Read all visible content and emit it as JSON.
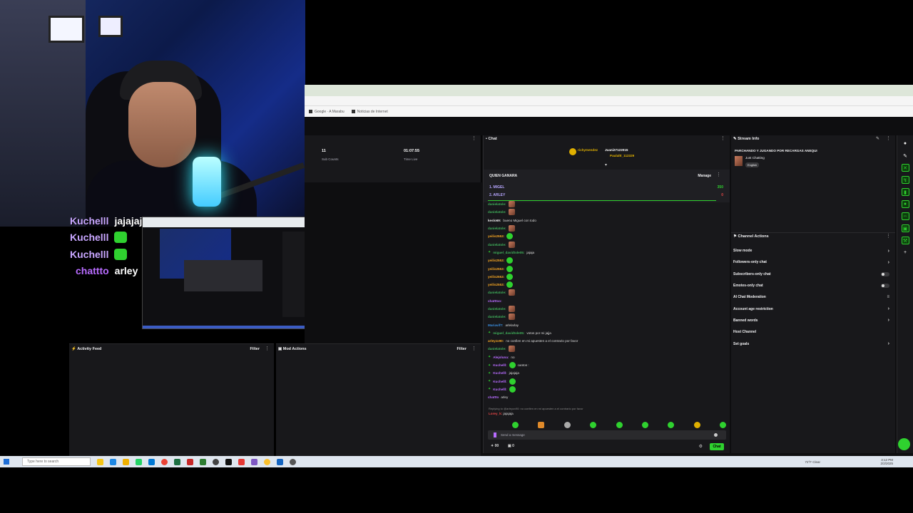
{
  "overlay_chat": [
    {
      "user": "Kuchelll",
      "msg": "jajajaja",
      "emote": false
    },
    {
      "user": "Kuchelll",
      "msg": "",
      "emote": true
    },
    {
      "user": "Kuchelll",
      "msg": "",
      "emote": true
    },
    {
      "user": "chattto",
      "msg": "arley",
      "emote": false
    }
  ],
  "bookmarks": [
    "Google · A Marabu",
    "Noticias de Internet"
  ],
  "stats": {
    "sub_value": "11",
    "sub_label": "Sub Counts",
    "time_value": "01:07:55",
    "time_label": "Time Live"
  },
  "chat": {
    "title": "Chat",
    "gifters": [
      {
        "name": "richymendez",
        "count": "1"
      },
      {
        "name": "Juani27122015",
        "count": "1"
      },
      {
        "name": "Paulaltt_112329",
        "count": "1"
      }
    ],
    "prediction": {
      "title": "QUIEN GANARA",
      "manage": "Manage",
      "options": [
        {
          "name": "1. MIGEL",
          "points": "350"
        },
        {
          "name": "2. ARLEY",
          "points": "0"
        }
      ]
    },
    "messages": [
      {
        "user": "danielatole:",
        "color": "#3fae5a",
        "text": "",
        "emote": "face",
        "badge": false
      },
      {
        "user": "danielatole:",
        "color": "#3fae5a",
        "text": "",
        "emote": "face",
        "badge": false
      },
      {
        "user": "keslo69:",
        "color": "#e9e9e9",
        "text": "bueno Miguel con todo",
        "emote": "",
        "badge": false
      },
      {
        "user": "danielatole:",
        "color": "#3fae5a",
        "text": "",
        "emote": "face",
        "badge": false
      },
      {
        "user": "yeilis2553:",
        "color": "#f5a623",
        "text": "",
        "emote": "green",
        "badge": false
      },
      {
        "user": "danielatole:",
        "color": "#3fae5a",
        "text": "",
        "emote": "face",
        "badge": false
      },
      {
        "user": "miguel_davidtole05:",
        "color": "#3fae5a",
        "text": "jajaja",
        "emote": "",
        "badge": true
      },
      {
        "user": "yeilis2553:",
        "color": "#f5a623",
        "text": "",
        "emote": "green",
        "badge": false
      },
      {
        "user": "yeilis2553:",
        "color": "#f5a623",
        "text": "",
        "emote": "green",
        "badge": false
      },
      {
        "user": "yeilis2553:",
        "color": "#f5a623",
        "text": "",
        "emote": "green",
        "badge": false
      },
      {
        "user": "yeilis2553:",
        "color": "#f5a623",
        "text": "",
        "emote": "green",
        "badge": false
      },
      {
        "user": "danielatole:",
        "color": "#3fae5a",
        "text": "",
        "emote": "face",
        "badge": false
      },
      {
        "user": "chatttoo:",
        "color": "#b86cff",
        "text": "",
        "emote": "",
        "badge": false
      },
      {
        "user": "danielatole:",
        "color": "#3fae5a",
        "text": "",
        "emote": "face",
        "badge": false
      },
      {
        "user": "danielatole:",
        "color": "#3fae5a",
        "text": "",
        "emote": "face",
        "badge": false
      },
      {
        "user": "Mariavif7:",
        "color": "#3a8fe0",
        "text": "arlelarlay",
        "emote": "",
        "badge": false
      },
      {
        "user": "miguel_davidtole05:",
        "color": "#3fae5a",
        "text": "votos por mi jajja",
        "emote": "",
        "badge": true
      },
      {
        "user": "arleyzx90:",
        "color": "#f5a623",
        "text": "no confien en mi apuesten a el contrario por favor",
        "emote": "",
        "badge": false
      },
      {
        "user": "danielatole:",
        "color": "#3fae5a",
        "text": "",
        "emote": "face",
        "badge": false
      },
      {
        "user": "Alejoluna:",
        "color": "#b86cff",
        "text": "no",
        "emote": "",
        "badge": true
      },
      {
        "user": "Kuchelll:",
        "color": "#b86cff",
        "text": "cantos :",
        "emote": "green",
        "badge": true
      },
      {
        "user": "Kuchelll:",
        "color": "#b86cff",
        "text": "jajajaja",
        "emote": "",
        "badge": true
      },
      {
        "user": "Kuchelll:",
        "color": "#b86cff",
        "text": "",
        "emote": "green",
        "badge": true
      },
      {
        "user": "Kuchelll:",
        "color": "#b86cff",
        "text": "",
        "emote": "green",
        "badge": true
      },
      {
        "user": "chattto",
        "color": "#b86cff",
        "text": "arley",
        "emote": "",
        "badge": false
      }
    ],
    "reply_hint": "Replying to @arleyzx90: no confien en mi apuesten a el contrario por favor",
    "reply_user": "Lorey_k:",
    "reply_text": "jajajaja",
    "input_placeholder": "Send a message",
    "points": "00",
    "bits": "0",
    "send_label": "Chat"
  },
  "stream_info": {
    "title": "Stream Info",
    "stream_title": "PARCHANDO Y JUGANDO POR RECARGAS ANEQUI",
    "category": "Just Chatting",
    "language": "English"
  },
  "channel_actions": {
    "title": "Channel Actions",
    "items": [
      {
        "label": "Slow mode",
        "control": "chevron"
      },
      {
        "label": "Followers-only chat",
        "control": "chevron"
      },
      {
        "label": "Subscribers-only chat",
        "control": "toggle"
      },
      {
        "label": "Emotes-only chat",
        "control": "toggle"
      },
      {
        "label": "AI Chat Moderation",
        "control": "settings"
      },
      {
        "label": "Account age restriction",
        "control": "chevron"
      },
      {
        "label": "Banned words",
        "control": "chevron"
      },
      {
        "label": "Host Channel",
        "control": "none"
      },
      {
        "label": "Set goals",
        "control": "chevron"
      }
    ]
  },
  "activity_feed": {
    "title": "Activity Feed",
    "filter": "Filter"
  },
  "mod_actions": {
    "title": "Mod Actions",
    "filter": "Filter"
  },
  "taskbar": {
    "search_placeholder": "Type here to search",
    "weather": "72°F Clear",
    "time": "3:12 PM",
    "date": "2/2/2025"
  },
  "colors": {
    "accent": "#2fd12f",
    "panel": "#18181b",
    "bg": "#0e0e10"
  }
}
